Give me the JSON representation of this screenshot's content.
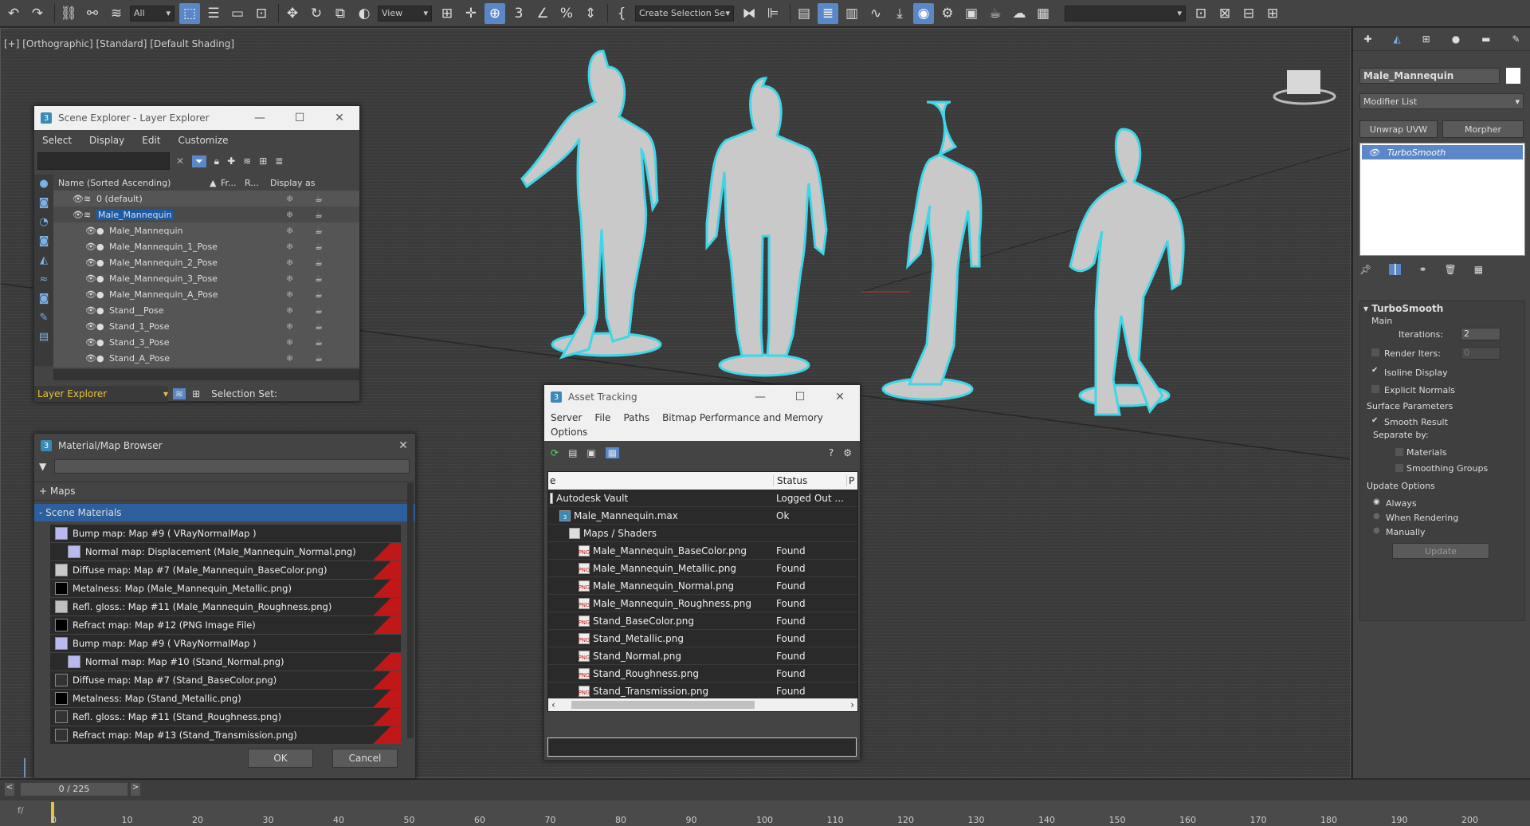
{
  "toolbar": {
    "filter_select": "All",
    "view_select": "View",
    "selection_set": "Create Selection Se"
  },
  "viewport": {
    "label": "[+] [Orthographic] [Standard] [Default Shading]"
  },
  "scene_explorer": {
    "title": "Scene Explorer - Layer Explorer",
    "menu": [
      "Select",
      "Display",
      "Edit",
      "Customize"
    ],
    "columns": {
      "name": "Name (Sorted Ascending)",
      "frozen": "Fr...",
      "render": "R...",
      "display": "Display as"
    },
    "rows": [
      {
        "name": "0 (default)",
        "level": 1
      },
      {
        "name": "Male_Mannequin",
        "level": 1
      },
      {
        "name": "Male_Mannequin",
        "level": 2
      },
      {
        "name": "Male_Mannequin_1_Pose",
        "level": 2
      },
      {
        "name": "Male_Mannequin_2_Pose",
        "level": 2
      },
      {
        "name": "Male_Mannequin_3_Pose",
        "level": 2
      },
      {
        "name": "Male_Mannequin_A_Pose",
        "level": 2
      },
      {
        "name": "Stand__Pose",
        "level": 2
      },
      {
        "name": "Stand_1_Pose",
        "level": 2
      },
      {
        "name": "Stand_3_Pose",
        "level": 2
      },
      {
        "name": "Stand_A_Pose",
        "level": 2
      }
    ],
    "footer_mode": "Layer Explorer",
    "selection_set_label": "Selection Set:"
  },
  "material_browser": {
    "title": "Material/Map Browser",
    "maps_label": "+ Maps",
    "scene_materials_label": "- Scene Materials",
    "items": [
      {
        "label": "Bump map: Map #9  ( VRayNormalMap )",
        "indent": 1,
        "swatch": "#b9b9f0",
        "red": false
      },
      {
        "label": "Normal map: Displacement (Male_Mannequin_Normal.png)",
        "indent": 2,
        "swatch": "#b9b9f0",
        "red": true
      },
      {
        "label": "Diffuse map: Map #7 (Male_Mannequin_BaseColor.png)",
        "indent": 1,
        "swatch": "#c8c8c8",
        "red": true
      },
      {
        "label": "Metalness: Map (Male_Mannequin_Metallic.png)",
        "indent": 1,
        "swatch": "#000000",
        "red": true
      },
      {
        "label": "Refl. gloss.: Map #11 (Male_Mannequin_Roughness.png)",
        "indent": 1,
        "swatch": "#bfbfbf",
        "red": true
      },
      {
        "label": "Refract map: Map #12 (PNG Image File)",
        "indent": 1,
        "swatch": "#000000",
        "red": true
      },
      {
        "label": "Bump map: Map #9  ( VRayNormalMap )",
        "indent": 1,
        "swatch": "#b9b9f0",
        "red": false
      },
      {
        "label": "Normal map: Map #10 (Stand_Normal.png)",
        "indent": 2,
        "swatch": "#b9b9f0",
        "red": true
      },
      {
        "label": "Diffuse map: Map #7 (Stand_BaseColor.png)",
        "indent": 1,
        "swatch": "#333333",
        "red": true
      },
      {
        "label": "Metalness: Map (Stand_Metallic.png)",
        "indent": 1,
        "swatch": "#000000",
        "red": true
      },
      {
        "label": "Refl. gloss.: Map #11 (Stand_Roughness.png)",
        "indent": 1,
        "swatch": "#333333",
        "red": true
      },
      {
        "label": "Refract map: Map #13 (Stand_Transmission.png)",
        "indent": 1,
        "swatch": "#333333",
        "red": true
      }
    ],
    "ok_label": "OK",
    "cancel_label": "Cancel"
  },
  "asset_tracking": {
    "title": "Asset Tracking",
    "menu": [
      "Server",
      "File",
      "Paths",
      "Bitmap Performance and Memory",
      "Options"
    ],
    "col_name": "e",
    "col_status": "Status",
    "col_p": "P",
    "rows": [
      {
        "name": "Autodesk Vault",
        "status": "Logged Out ...",
        "indent": 0,
        "icon": "vault"
      },
      {
        "name": "Male_Mannequin.max",
        "status": "Ok",
        "indent": 1,
        "icon": "max"
      },
      {
        "name": "Maps / Shaders",
        "status": "",
        "indent": 2,
        "icon": "folder"
      },
      {
        "name": "Male_Mannequin_BaseColor.png",
        "status": "Found",
        "indent": 3,
        "icon": "png"
      },
      {
        "name": "Male_Mannequin_Metallic.png",
        "status": "Found",
        "indent": 3,
        "icon": "png"
      },
      {
        "name": "Male_Mannequin_Normal.png",
        "status": "Found",
        "indent": 3,
        "icon": "png"
      },
      {
        "name": "Male_Mannequin_Roughness.png",
        "status": "Found",
        "indent": 3,
        "icon": "png"
      },
      {
        "name": "Stand_BaseColor.png",
        "status": "Found",
        "indent": 3,
        "icon": "png"
      },
      {
        "name": "Stand_Metallic.png",
        "status": "Found",
        "indent": 3,
        "icon": "png"
      },
      {
        "name": "Stand_Normal.png",
        "status": "Found",
        "indent": 3,
        "icon": "png"
      },
      {
        "name": "Stand_Roughness.png",
        "status": "Found",
        "indent": 3,
        "icon": "png"
      },
      {
        "name": "Stand_Transmission.png",
        "status": "Found",
        "indent": 3,
        "icon": "png"
      }
    ]
  },
  "command_panel": {
    "object_name": "Male_Mannequin",
    "modifier_list": "Modifier List",
    "btn_unwrap": "Unwrap UVW",
    "btn_morpher": "Morpher",
    "stack_item": "TurboSmooth",
    "rollout_title": "TurboSmooth",
    "main_label": "Main",
    "iterations_label": "Iterations:",
    "iterations_value": "2",
    "render_iters_label": "Render Iters:",
    "render_iters_value": "0",
    "isoline_label": "Isoline Display",
    "explicit_label": "Explicit Normals",
    "surface_label": "Surface Parameters",
    "smooth_label": "Smooth Result",
    "separate_label": "Separate by:",
    "materials_label": "Materials",
    "smoothing_label": "Smoothing Groups",
    "update_options_label": "Update Options",
    "always_label": "Always",
    "when_rendering_label": "When Rendering",
    "manually_label": "Manually",
    "update_btn": "Update"
  },
  "timeline": {
    "frame_display": "0 / 225",
    "ticks": [
      "0",
      "10",
      "20",
      "30",
      "40",
      "50",
      "60",
      "70",
      "80",
      "90",
      "100",
      "110",
      "120",
      "130",
      "140",
      "150",
      "160",
      "170",
      "180",
      "190",
      "200",
      "2"
    ]
  },
  "colors": {
    "accent": "#5b87c7",
    "selection_outline": "#3ed6e8",
    "missing": "#c01818"
  }
}
